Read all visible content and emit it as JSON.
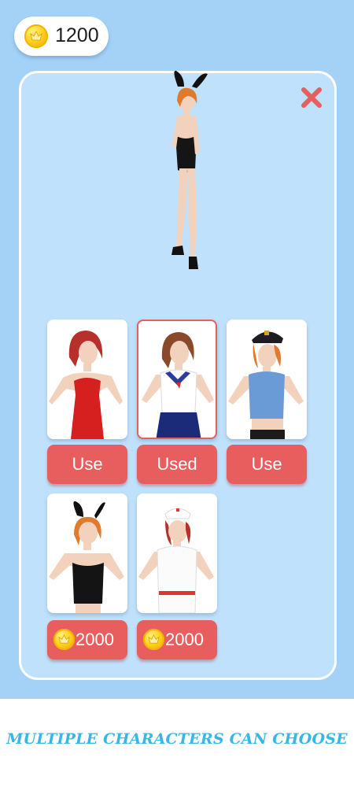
{
  "header": {
    "coin_balance": "1200",
    "coin_icon": "crown-coin-icon"
  },
  "panel": {
    "close_icon": "close-x-icon",
    "accent_color": "#e85e5e",
    "preview_character": "bunny-outfit",
    "characters": [
      {
        "outfit": "red-dress",
        "button_label": "Use",
        "selected": false
      },
      {
        "outfit": "school-uniform",
        "button_label": "Used",
        "selected": true
      },
      {
        "outfit": "police-uniform",
        "button_label": "Use",
        "selected": false
      },
      {
        "outfit": "bunny-outfit",
        "price": "2000",
        "selected": false
      },
      {
        "outfit": "nurse-uniform",
        "price": "2000",
        "selected": false
      }
    ]
  },
  "banner": {
    "text": "MULTIPLE CHARACTERS CAN CHOOSE",
    "color": "#38b7e6"
  }
}
